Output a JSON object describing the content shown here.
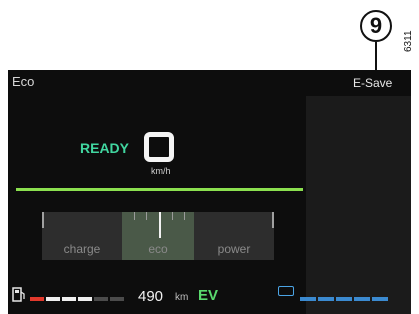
{
  "callout": {
    "number": "9",
    "doc_code": "6311"
  },
  "header": {
    "mode": "Eco",
    "right_label": "E-Save"
  },
  "status": {
    "ready": "READY",
    "speed_unit": "km/h"
  },
  "gauge": {
    "labels": [
      "charge",
      "eco",
      "power"
    ],
    "active": "eco"
  },
  "bottom": {
    "range_value": "490",
    "range_unit": "km",
    "drive_mode": "EV",
    "fuel_level_fraction": 0.6,
    "battery_level_fraction": 0.8
  },
  "colors": {
    "ready": "#41d6a0",
    "accent_line": "#8be04f",
    "ev": "#5ad96e",
    "battery": "#3b8ad0",
    "fuel_low": "#e2392c"
  },
  "icons": [
    "fuel-pump-icon",
    "battery-icon"
  ]
}
